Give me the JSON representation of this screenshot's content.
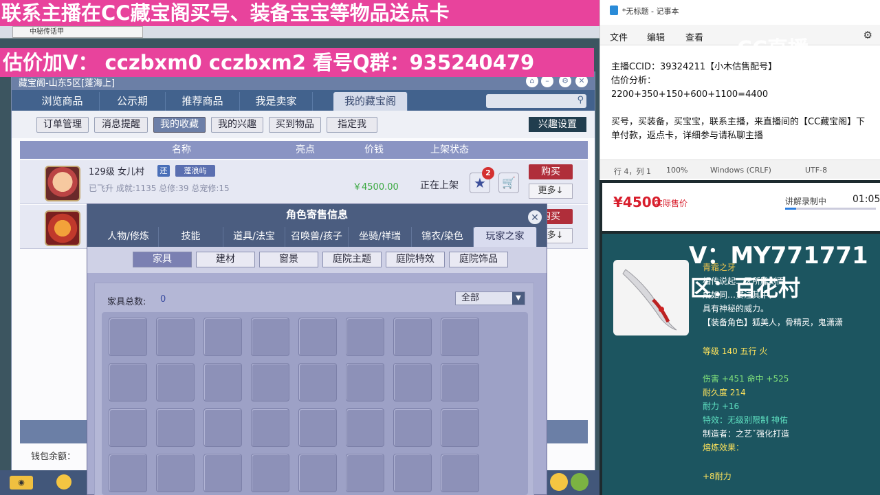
{
  "stream": {
    "banner_top": "联系主播在CC藏宝阁买号、装备宝宝等物品送点卡",
    "banner_price": "估价加V： cczbxm0 cczbxm2 看号Q群：935240479",
    "v_overlay": "V：MY771771",
    "zone_overlay": "区：百花村",
    "cc_logo": "CC直播"
  },
  "browser": {
    "tab_label": "中秘传话甲"
  },
  "window": {
    "title": "藏宝阁-山东5区[蓬海上]",
    "nav_tabs": [
      "浏览商品",
      "公示期",
      "推荐商品",
      "我是卖家",
      "我的藏宝阁"
    ],
    "sub_tabs": [
      "订单管理",
      "消息提醒",
      "我的收藏",
      "我的兴趣",
      "买到物品",
      "指定我"
    ],
    "interest_settings": "兴趣设置",
    "table_headers": [
      "名称",
      "亮点",
      "价钱",
      "上架状态"
    ],
    "rows": [
      {
        "level": "129级 女儿村",
        "tag1": "还",
        "tag2": "蓬浪屿",
        "stats": "已飞升 成就:1135 总修:39 总宠修:15",
        "price": "￥4500.00",
        "status": "正在上架",
        "badge": "2",
        "buy": "购买",
        "more": "更多↓"
      },
      {
        "buy": "购买",
        "more": "更多↓"
      }
    ],
    "wallet": "钱包余额："
  },
  "modal": {
    "title": "角色寄售信息",
    "tabs": [
      "人物/修炼",
      "技能",
      "道具/法宝",
      "召唤兽/孩子",
      "坐骑/祥瑞",
      "锦衣/染色",
      "玩家之家"
    ],
    "sub_tabs": [
      "家具",
      "建材",
      "窗景",
      "庭院主题",
      "庭院特效",
      "庭院饰品"
    ],
    "furniture_count_label": "家具总数:",
    "furniture_count": "0",
    "filter_select": "全部"
  },
  "notepad": {
    "title": "*无标题 - 记事本",
    "menu": [
      "文件",
      "编辑",
      "查看"
    ],
    "lines": [
      "主播CCID：39324211【小木估售配号】",
      "估价分析：",
      "2200+350+150+600+1100=4400",
      "",
      "买号，买装备，买宝宝，联系主播，来直播间的【CC藏宝阁】下单付款，返点卡，详细参与请私聊主播"
    ],
    "status": [
      "行 4，列 1",
      "100%",
      "Windows (CRLF)",
      "UTF-8"
    ]
  },
  "price_panel": {
    "price": "¥4500",
    "price_label": "实际售价",
    "rec_label": "讲解录制中",
    "rec_time": "01:05",
    "rec_progress": 0.12
  },
  "item": {
    "name": "青霜之牙",
    "desc_lines": [
      "相传说起…牙所雕刻而",
      "成如同…贯注其中，",
      "具有神秘的威力。"
    ],
    "roles": "【装备角色】狐美人，骨精灵，鬼潇潇",
    "grade": "等级 140 五行 火",
    "attr1": "伤害 +451 命中 +525",
    "durability": "耐久度 214",
    "stamina": "耐力 +16",
    "effect": "特效：无级别限制 神佑",
    "maker": "制造者：之艺ˇ强化打造",
    "refine": "熔炼效果：",
    "refine_val": "+8耐力"
  }
}
